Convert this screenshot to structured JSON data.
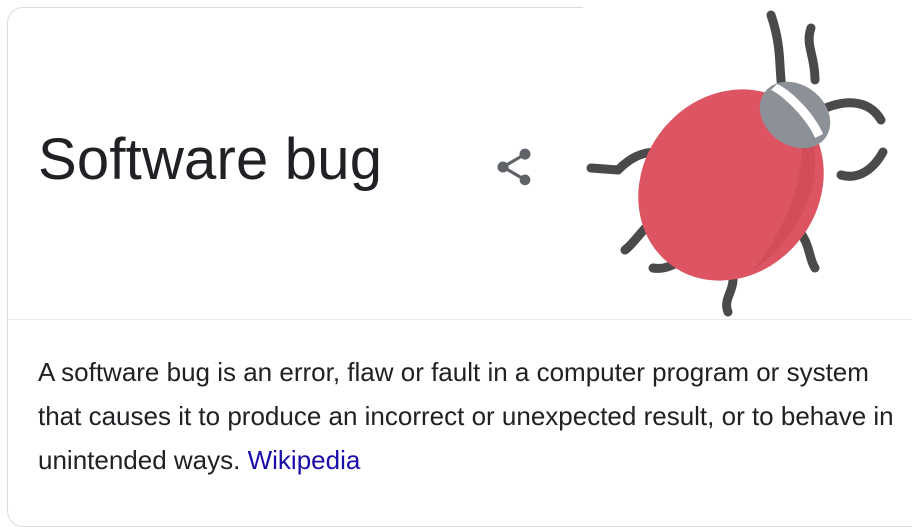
{
  "knowledge_panel": {
    "title": "Software bug",
    "share_icon": "share-icon",
    "image_icon": "bug-illustration",
    "description": "A software bug is an error, flaw or fault in a computer program or system that causes it to produce an incorrect or unexpected result, or to behave in unintended ways.",
    "source_link": "Wikipedia"
  },
  "colors": {
    "title_text": "#202124",
    "link": "#1a0dab",
    "bug_body": "#dd5563",
    "bug_head": "#8c9198",
    "bug_legs": "#4a4a4a"
  }
}
